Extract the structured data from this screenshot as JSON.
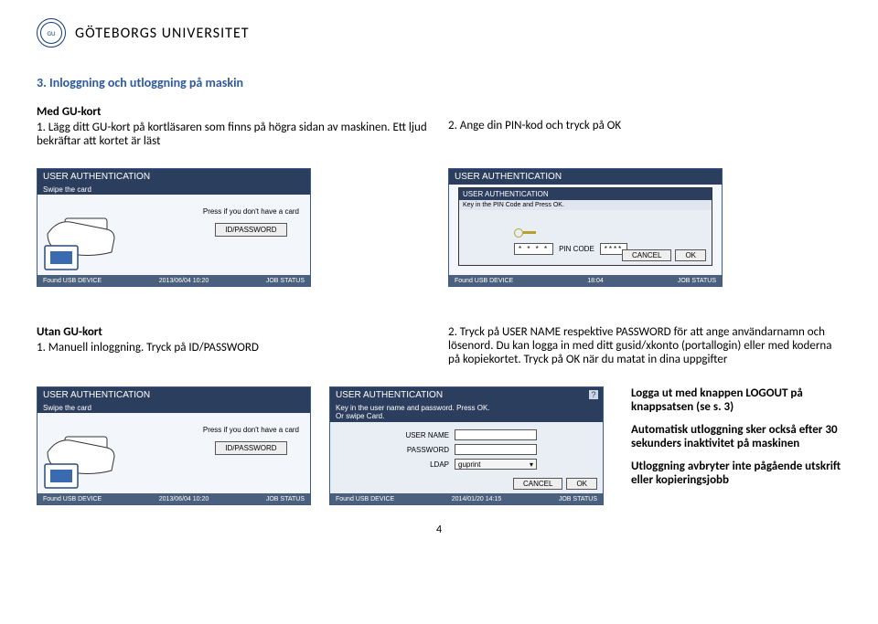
{
  "header": {
    "university": "GÖTEBORGS UNIVERSITET"
  },
  "section": {
    "heading": "3. Inloggning och utloggning på maskin",
    "med_gu_kort_title": "Med GU-kort",
    "med_gu_kort_step1": "1. Lägg ditt GU-kort på kortläsaren som finns på högra sidan av maskinen. Ett ljud bekräftar att kortet är läst",
    "med_gu_kort_step2": "2. Ange din PIN-kod och tryck på OK",
    "utan_gu_kort_title": "Utan GU-kort",
    "utan_step1": "1. Manuell inloggning. Tryck på ID/PASSWORD",
    "utan_step2": "2. Tryck på USER NAME respektive PASSWORD för att ange användarnamn och lösenord. Du kan logga in med ditt gusid/xkonto (portallogin) eller med koderna på kopiekortet. Tryck på OK när du matat in dina uppgifter",
    "logout_note1": "Logga ut med knappen LOGOUT på knappsatsen (se s. 3)",
    "logout_note2": "Automatisk utloggning sker också efter 30 sekunders inaktivitet på maskinen",
    "logout_note3": "Utloggning avbryter inte pågående utskrift eller kopieringsjobb"
  },
  "panel_swipe": {
    "title": "USER AUTHENTICATION",
    "subtitle": "Swipe the card",
    "prompt": "Press if you don't have a card",
    "btn": "ID/PASSWORD",
    "status_left": "Found USB DEVICE",
    "status_date": "2013/06/04",
    "status_time": "10:20",
    "status_right": "JOB STATUS"
  },
  "panel_pin": {
    "outer_title": "USER AUTHENTICATION",
    "dlg_title": "USER AUTHENTICATION",
    "dlg_sub": "Key in the PIN Code and Press OK.",
    "pin_label": "PIN CODE",
    "pin_mask": "* * * *",
    "pin_value": "****",
    "cancel": "CANCEL",
    "ok": "OK",
    "status_left": "Found USB DEVICE",
    "status_time": "18:04",
    "status_right": "JOB STATUS"
  },
  "panel_login": {
    "title": "USER AUTHENTICATION",
    "sub1": "Key in the user name and password. Press OK.",
    "sub2": "Or swipe Card.",
    "user_label": "USER NAME",
    "pass_label": "PASSWORD",
    "ldap_label": "LDAP",
    "ldap_value": "guprint",
    "cancel": "CANCEL",
    "ok": "OK",
    "help": "?",
    "status_left": "Found USB DEVICE",
    "status_date": "2014/01/20",
    "status_time": "14:15",
    "status_right": "JOB STATUS"
  },
  "page_number": "4"
}
